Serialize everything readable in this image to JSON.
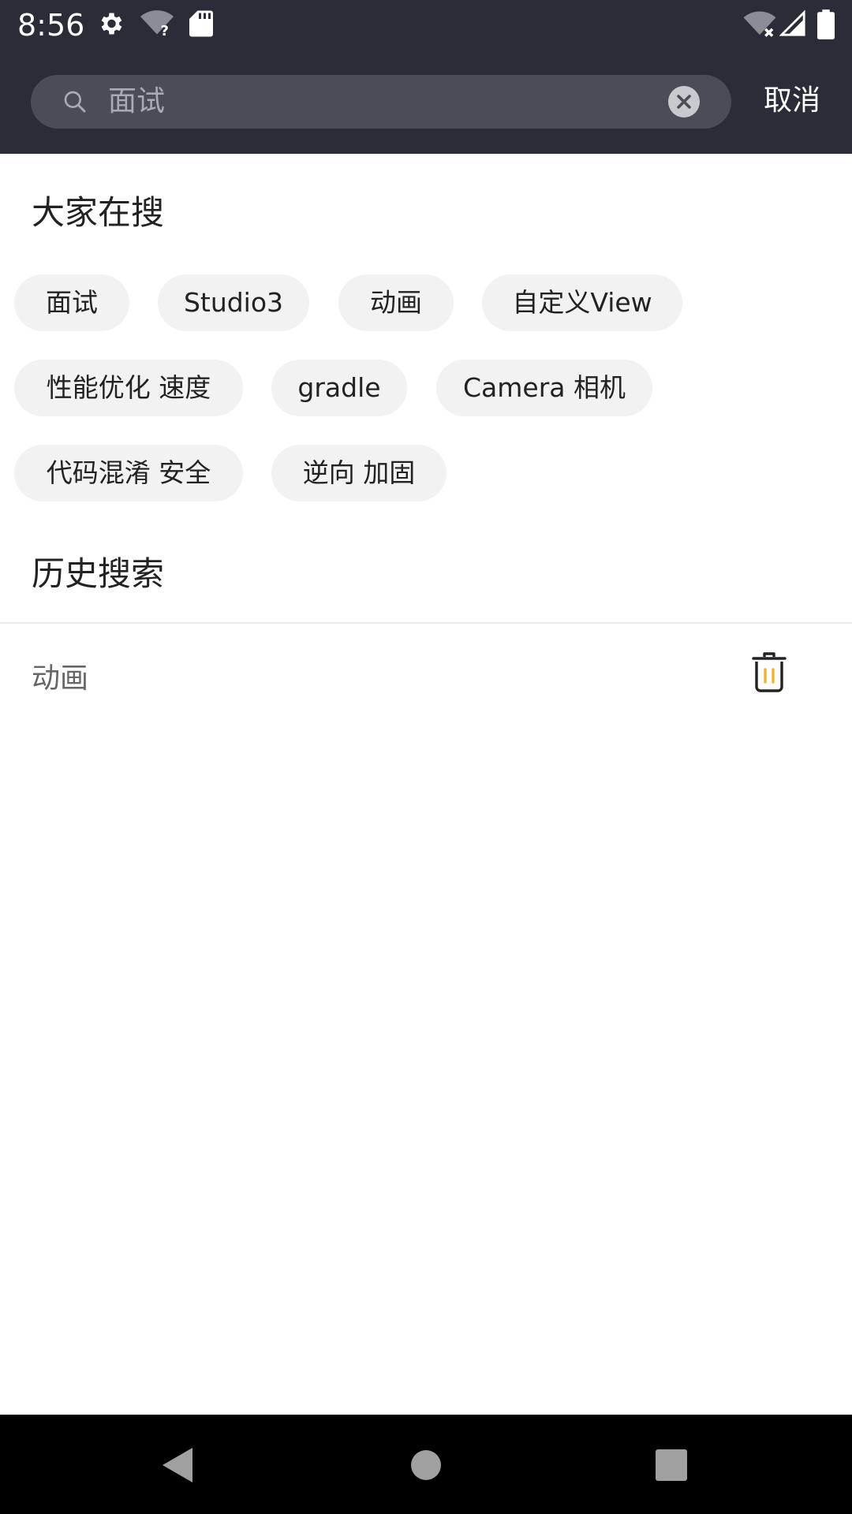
{
  "status_bar": {
    "time": "8:56",
    "left_icons": [
      "settings-gear-icon",
      "wifi-question-icon",
      "sd-card-icon"
    ],
    "right_icons": [
      "wifi-off-icon",
      "cell-signal-icon",
      "battery-icon"
    ]
  },
  "search": {
    "query": "面试",
    "cancel_label": "取消"
  },
  "hot": {
    "title": "大家在搜",
    "tags": [
      "面试",
      "Studio3",
      "动画",
      "自定义View",
      "性能优化 速度",
      "gradle",
      "Camera 相机",
      "代码混淆 安全",
      "逆向 加固"
    ]
  },
  "history": {
    "title": "历史搜索",
    "items": [
      {
        "label": "动画"
      }
    ]
  },
  "colors": {
    "header_bg": "#2a2c38",
    "search_bg": "#4a4c58",
    "tag_bg": "#f2f2f2",
    "trash_accent": "#f0b429"
  },
  "nav_bar": {
    "buttons": [
      "back-icon",
      "home-icon",
      "recents-icon"
    ]
  }
}
